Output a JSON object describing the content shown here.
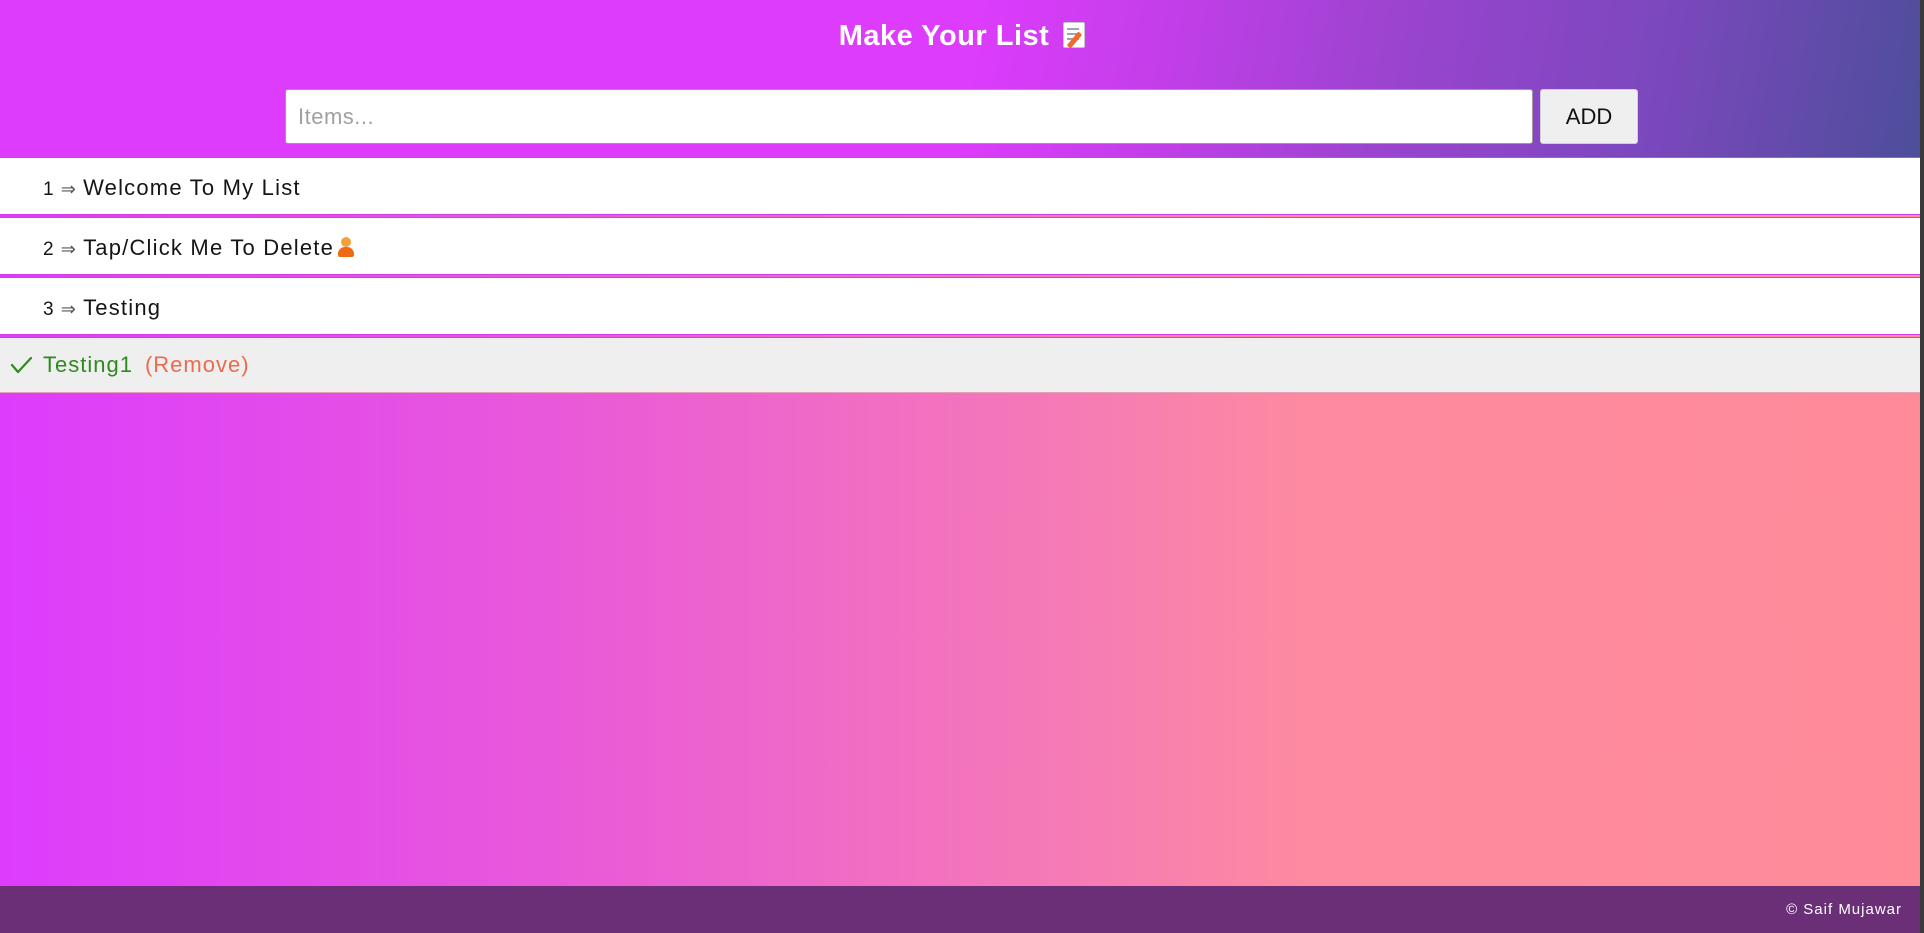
{
  "header": {
    "title": "Make Your List",
    "title_icon": "memo-icon"
  },
  "input": {
    "placeholder": "Items...",
    "value": ""
  },
  "add_button": {
    "label": "ADD"
  },
  "list_items": [
    {
      "number": "1",
      "arrow": "⇒",
      "text": "Welcome To My List"
    },
    {
      "number": "2",
      "arrow": "⇒",
      "text": "Tap/Click Me To Delete",
      "icon": "person-icon"
    },
    {
      "number": "3",
      "arrow": "⇒",
      "text": "Testing"
    }
  ],
  "completed_item": {
    "text": "Testing1",
    "remove_label": "(Remove)",
    "icon": "check-icon"
  },
  "footer": {
    "text": "© Saif Mujawar"
  },
  "colors": {
    "background_start": "#dd3cfd",
    "background_end": "#ff8b99",
    "completed_text": "#2e8a1e",
    "remove_link": "#ee6a4d",
    "footer_bg": "#6a2f77"
  }
}
